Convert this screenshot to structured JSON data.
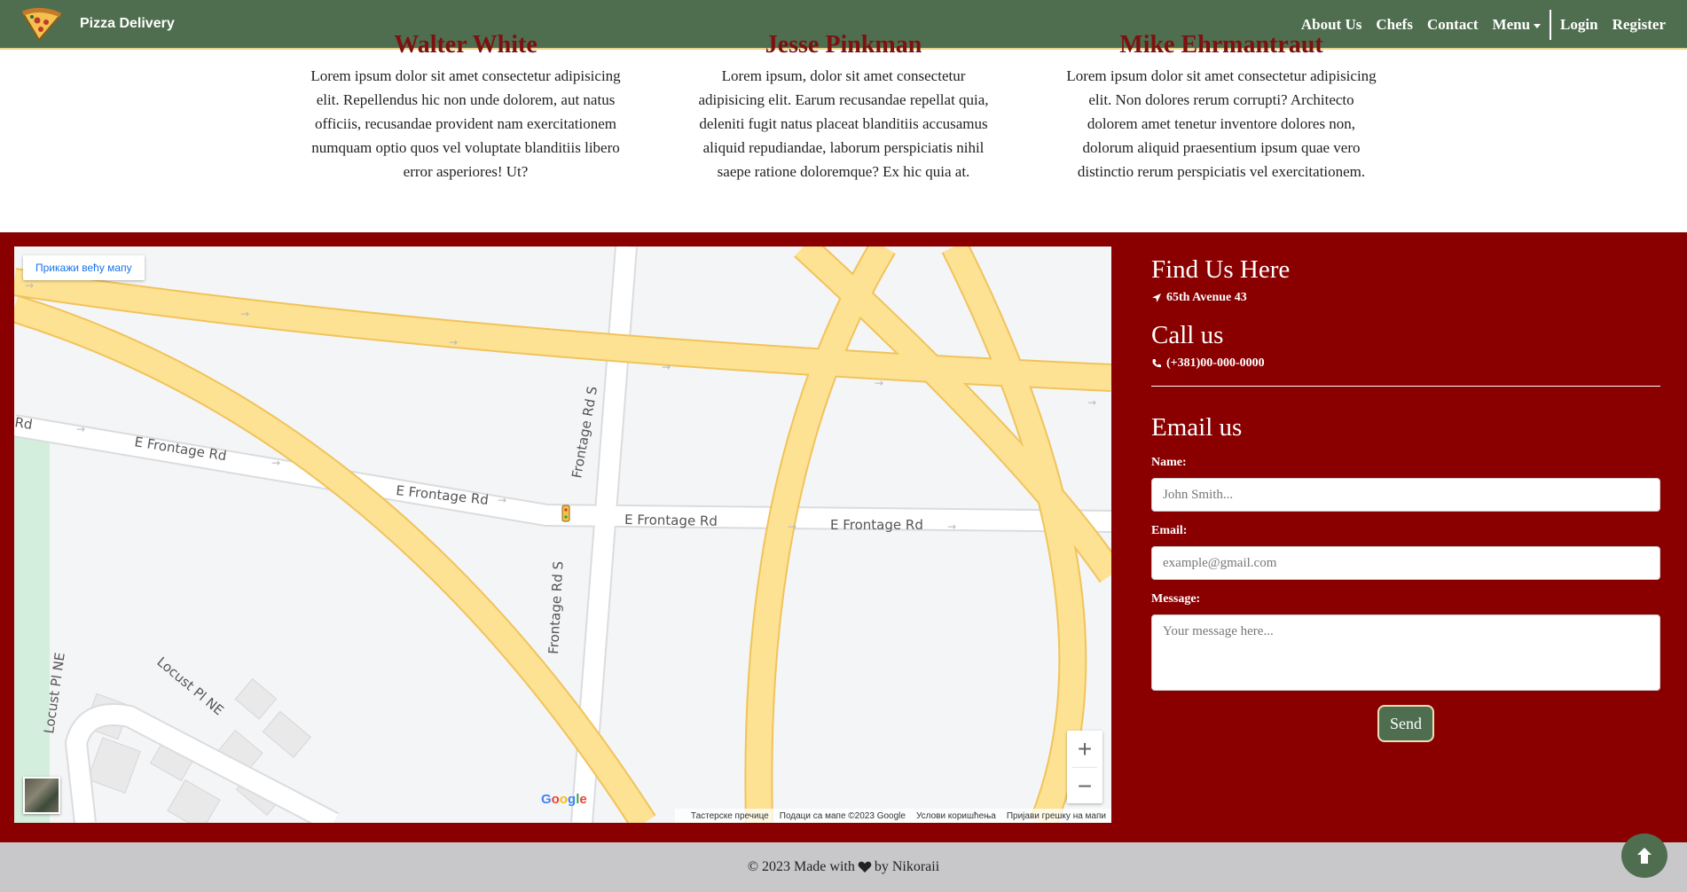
{
  "navbar": {
    "brand": "Pizza Delivery",
    "links": [
      "About Us",
      "Chefs",
      "Contact",
      "Menu"
    ],
    "auth": [
      "Login",
      "Register"
    ],
    "colors": {
      "background": "#4f6e4f",
      "border": "#e7d48a"
    }
  },
  "chefs": [
    {
      "name": "Walter White",
      "text": "Lorem ipsum dolor sit amet consectetur adipisicing elit. Repellendus hic non unde dolorem, aut natus officiis, recusandae provident nam exercitationem numquam optio quos vel voluptate blanditiis libero error asperiores! Ut?"
    },
    {
      "name": "Jesse Pinkman",
      "text": "Lorem ipsum, dolor sit amet consectetur adipisicing elit. Earum recusandae repellat quia, deleniti fugit natus placeat blanditiis accusamus aliquid repudiandae, laborum perspiciatis nihil saepe ratione doloremque? Ex hic quia at."
    },
    {
      "name": "Mike Ehrmantraut",
      "text": "Lorem ipsum dolor sit amet consectetur adipisicing elit. Non dolores rerum corrupti? Architecto dolorem amet tenetur inventore dolores non, dolorum aliquid praesentium ipsum quae vero distinctio rerum perspiciatis vel exercitationem."
    }
  ],
  "map": {
    "view_larger": "Прикажи већу мапу",
    "roads": [
      "Rd",
      "E Frontage Rd",
      "E Frontage Rd",
      "E Frontage Rd",
      "E Frontage Rd",
      "Frontage Rd S",
      "Frontage Rd S",
      "Locust Pl NE",
      "Locust Pl NE"
    ],
    "zoom_in": "+",
    "zoom_out": "−",
    "google": "Google",
    "attribution": [
      "Тастерске пречице",
      "Подаци са мапе ©2023 Google",
      "Услови коришћења",
      "Пријави грешку на мапи"
    ]
  },
  "contact": {
    "find_title": "Find Us Here",
    "address": "65th Avenue 43",
    "call_title": "Call us",
    "phone": "(+381)00-000-0000",
    "email_title": "Email us",
    "name_label": "Name:",
    "name_placeholder": "John Smith...",
    "email_label": "Email:",
    "email_placeholder": "example@gmail.com",
    "message_label": "Message:",
    "message_placeholder": "Your message here...",
    "send": "Send",
    "colors": {
      "section": "#8a0000"
    }
  },
  "footer": {
    "before": "© 2023 Made with",
    "after": "by Nikoraii",
    "icons": [
      "heart-icon",
      "arrow-up-icon"
    ]
  }
}
